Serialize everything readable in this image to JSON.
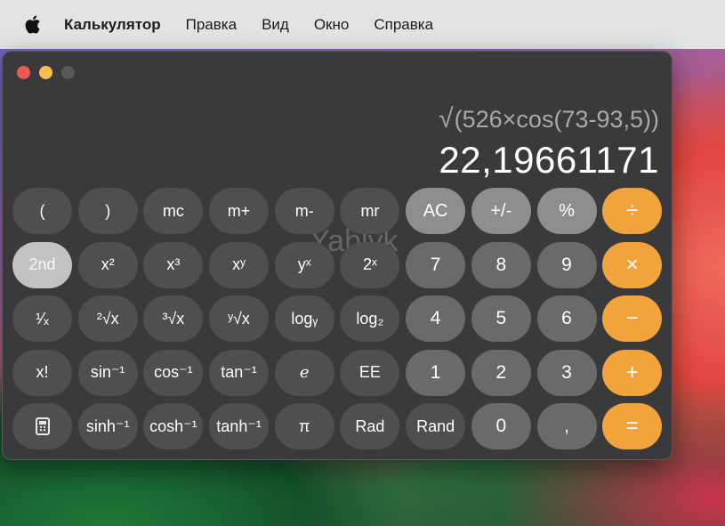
{
  "menubar": {
    "app_name": "Калькулятор",
    "items": [
      "Правка",
      "Вид",
      "Окно",
      "Справка"
    ]
  },
  "display": {
    "expression": "(526×cos(73-93,5))",
    "result": "22,19661171"
  },
  "watermark": "Yablyk",
  "keys": {
    "row1": [
      "(",
      ")",
      "mc",
      "m+",
      "m-",
      "mr",
      "AC",
      "+/-",
      "%",
      "÷"
    ],
    "row2": [
      "2nd",
      "x²",
      "x³",
      "xʸ",
      "yˣ",
      "2ˣ",
      "7",
      "8",
      "9",
      "×"
    ],
    "row3": [
      "¹⁄ₓ",
      "²√x",
      "³√x",
      "ʸ√x",
      "logᵧ",
      "log₂",
      "4",
      "5",
      "6",
      "−"
    ],
    "row4": [
      "x!",
      "sin⁻¹",
      "cos⁻¹",
      "tan⁻¹",
      "e",
      "EE",
      "1",
      "2",
      "3",
      "+"
    ],
    "row5": [
      "",
      "sinh⁻¹",
      "cosh⁻¹",
      "tanh⁻¹",
      "π",
      "Rad",
      "Rand",
      "0",
      ",",
      "="
    ]
  },
  "colors": {
    "operator": "#f2a33b",
    "digit": "#6a6a6d",
    "function": "#4f4f52",
    "utility": "#8e8e91"
  }
}
